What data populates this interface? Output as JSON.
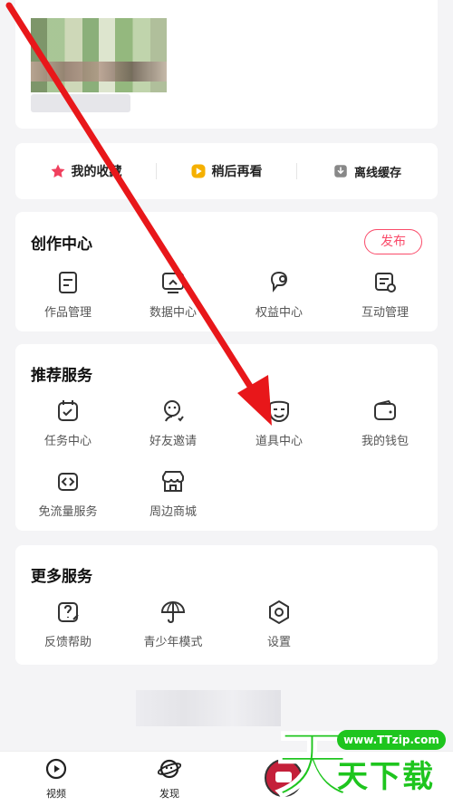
{
  "quick_access": [
    {
      "label": "我的收藏",
      "icon": "star-icon",
      "color": "#f0405e"
    },
    {
      "label": "稍后再看",
      "icon": "play-later-icon",
      "color": "#f5b000"
    },
    {
      "label": "离线缓存",
      "icon": "download-icon",
      "color": "#888888"
    }
  ],
  "creation": {
    "title": "创作中心",
    "publish_label": "发布",
    "items": [
      {
        "label": "作品管理",
        "icon": "works-icon"
      },
      {
        "label": "数据中心",
        "icon": "data-icon"
      },
      {
        "label": "权益中心",
        "icon": "rights-icon"
      },
      {
        "label": "互动管理",
        "icon": "interaction-icon"
      }
    ]
  },
  "recommended": {
    "title": "推荐服务",
    "items": [
      {
        "label": "任务中心",
        "icon": "task-icon"
      },
      {
        "label": "好友邀请",
        "icon": "invite-icon"
      },
      {
        "label": "道具中心",
        "icon": "props-icon"
      },
      {
        "label": "我的钱包",
        "icon": "wallet-icon"
      },
      {
        "label": "免流量服务",
        "icon": "data-free-icon"
      },
      {
        "label": "周边商城",
        "icon": "shop-icon"
      }
    ]
  },
  "more": {
    "title": "更多服务",
    "items": [
      {
        "label": "反馈帮助",
        "icon": "feedback-icon"
      },
      {
        "label": "青少年模式",
        "icon": "umbrella-icon"
      },
      {
        "label": "设置",
        "icon": "settings-icon"
      }
    ]
  },
  "bottom_nav": [
    {
      "label": "视频",
      "icon": "video-icon"
    },
    {
      "label": "发现",
      "icon": "discover-icon"
    }
  ],
  "watermark": {
    "url": "www.TTzip.com",
    "text": "天下载"
  },
  "colors": {
    "accent": "#fa4b6a",
    "arrow": "#e8171a",
    "watermark_green": "#1ec51e"
  }
}
